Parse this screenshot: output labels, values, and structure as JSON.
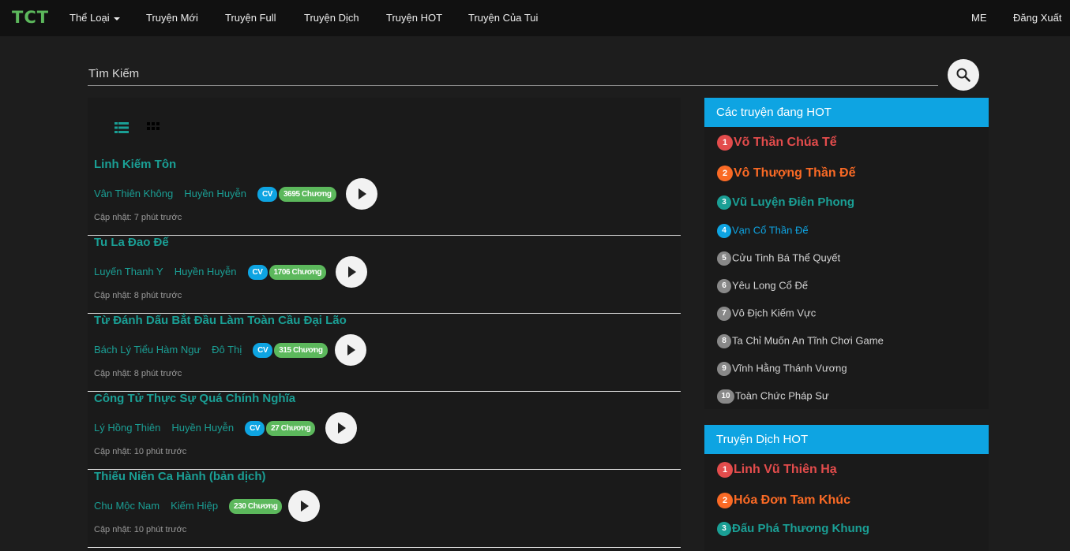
{
  "nav": {
    "logo": "TCT",
    "items": [
      "Thể Loại",
      "Truyện Mới",
      "Truyện Full",
      "Truyện Dịch",
      "Truyện HOT",
      "Truyện Của Tui"
    ],
    "me": "ME",
    "logout": "Đăng Xuất"
  },
  "search": {
    "placeholder": "Tìm Kiếm",
    "icon": "search-icon"
  },
  "stories": [
    {
      "title": "Linh Kiếm Tôn",
      "author": "Vân Thiên Không",
      "genre": "Huyền Huyễn",
      "cv": "CV",
      "chapters": "3695 Chương",
      "updated": "Cập nhật: 7 phút trước"
    },
    {
      "title": "Tu La Đao Đế",
      "author": "Luyến Thanh Y",
      "genre": "Huyền Huyễn",
      "cv": "CV",
      "chapters": "1706 Chương",
      "updated": "Cập nhật: 8 phút trước"
    },
    {
      "title": "Từ Đánh Dấu Bắt Đầu Làm Toàn Cầu Đại Lão",
      "author": "Bách Lý Tiểu Hàm Ngư",
      "genre": "Đô Thị",
      "cv": "CV",
      "chapters": "315 Chương",
      "updated": "Cập nhật: 8 phút trước"
    },
    {
      "title": "Công Tử Thực Sự Quá Chính Nghĩa",
      "author": "Lý Hồng Thiên",
      "genre": "Huyền Huyễn",
      "cv": "CV",
      "chapters": "27 Chương",
      "updated": "Cập nhật: 10 phút trước"
    },
    {
      "title": "Thiếu Niên Ca Hành (bản dịch)",
      "author": "Chu Mộc Nam",
      "genre": "Kiếm Hiệp",
      "cv": "",
      "chapters": "230 Chương",
      "updated": "Cập nhật: 10 phút trước"
    }
  ],
  "hot": {
    "title": "Các truyện đang HOT",
    "items": [
      "Võ Thần Chúa Tể",
      "Vô Thượng Thần Đế",
      "Vũ Luyện Điên Phong",
      "Vạn Cổ Thần Đế",
      "Cửu Tinh Bá Thể Quyết",
      "Yêu Long Cổ Đế",
      "Vô Địch Kiếm Vực",
      "Ta Chỉ Muốn An Tĩnh Chơi Game",
      "Vĩnh Hằng Thánh Vương",
      "Toàn Chức Pháp Sư"
    ]
  },
  "hot_dich": {
    "title": "Truyện Dịch HOT",
    "items": [
      "Linh Vũ Thiên Hạ",
      "Hóa Đơn Tam Khúc",
      "Đấu Phá Thương Khung"
    ]
  },
  "colors": {
    "accent": "#1a9f95",
    "header": "#0ea4e2",
    "chapter_badge": "#5cb85c",
    "rank1": "#e34c4c",
    "rank2": "#fa6a25"
  }
}
